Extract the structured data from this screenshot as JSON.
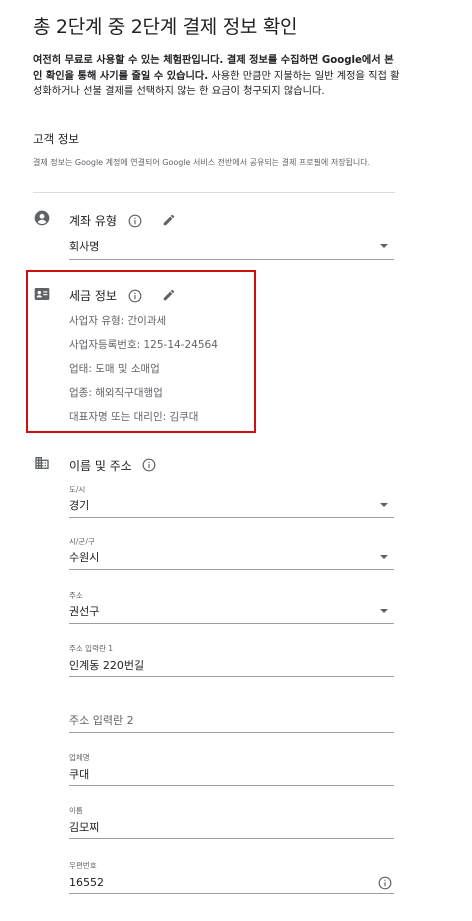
{
  "page": {
    "title": "총 2단계 중 2단계 결제 정보 확인",
    "intro_bold": "여전히 무료로 사용할 수 있는 체험판입니다. 결제 정보를 수집하면 Google에서 본인 확인을 통해 사기를 줄일 수 있습니다.",
    "intro_rest": " 사용한 만큼만 지불하는 일반 계정을 직접 활성화하거나 선불 결제를 선택하지 않는 한 요금이 청구되지 않습니다."
  },
  "customer": {
    "heading": "고객 정보",
    "subtext": "결제 정보는 Google 계정에 연결되어 Google 서비스 전반에서 공유되는 결제 프로필에 저장됩니다."
  },
  "account_type": {
    "label": "계좌 유형",
    "icon": "account-circle-icon",
    "value": "회사명"
  },
  "tax_info": {
    "label": "세금 정보",
    "icon": "id-card-icon",
    "lines": [
      "사업자 유형: 간이과세",
      "사업자등록번호: 125-14-24564",
      "업태: 도매 및 소매업",
      "업종: 해외직구대행업",
      "대표자명 또는 대리인: 김쿠대"
    ],
    "highlight_color": "#d01010"
  },
  "name_address": {
    "label": "이름 및 주소",
    "icon": "building-icon",
    "fields": {
      "province": {
        "label": "도/시",
        "value": "경기"
      },
      "city": {
        "label": "시/군/구",
        "value": "수원시"
      },
      "district": {
        "label": "주소",
        "value": "권선구"
      },
      "address1": {
        "label": "주소 입력란 1",
        "value": "인계동 220번길"
      },
      "address2": {
        "placeholder": "주소 입력란 2"
      },
      "company": {
        "label": "업체명",
        "value": "쿠대"
      },
      "name": {
        "label": "이름",
        "value": "김모찌"
      },
      "postal": {
        "label": "우편번호",
        "value": "16552"
      }
    }
  }
}
